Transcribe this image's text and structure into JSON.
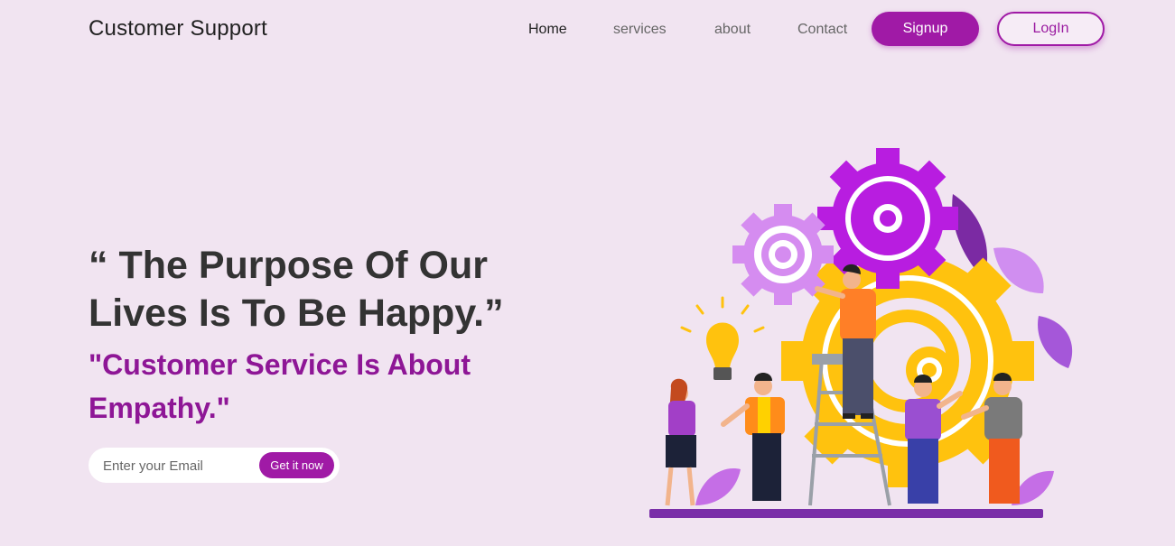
{
  "brand": {
    "title": "Customer Support"
  },
  "nav": {
    "items": [
      "Home",
      "services",
      "about",
      "Contact"
    ],
    "signup_label": "Signup",
    "login_label": "LogIn"
  },
  "hero": {
    "title": "“ The Purpose Of Our Lives Is To Be Happy.”",
    "subtitle": "\"Customer Service Is About Empathy.\"",
    "email_placeholder": "Enter your Email",
    "cta_label": "Get it now"
  },
  "colors": {
    "accent": "#a01aa6",
    "background": "#f1e4f1",
    "subtitle": "#8e1696",
    "gear_purple": "#b81de0",
    "gear_light": "#d58cf0",
    "gear_yellow": "#ffc20e"
  },
  "illustration": {
    "name": "teamwork-gears-illustration"
  }
}
